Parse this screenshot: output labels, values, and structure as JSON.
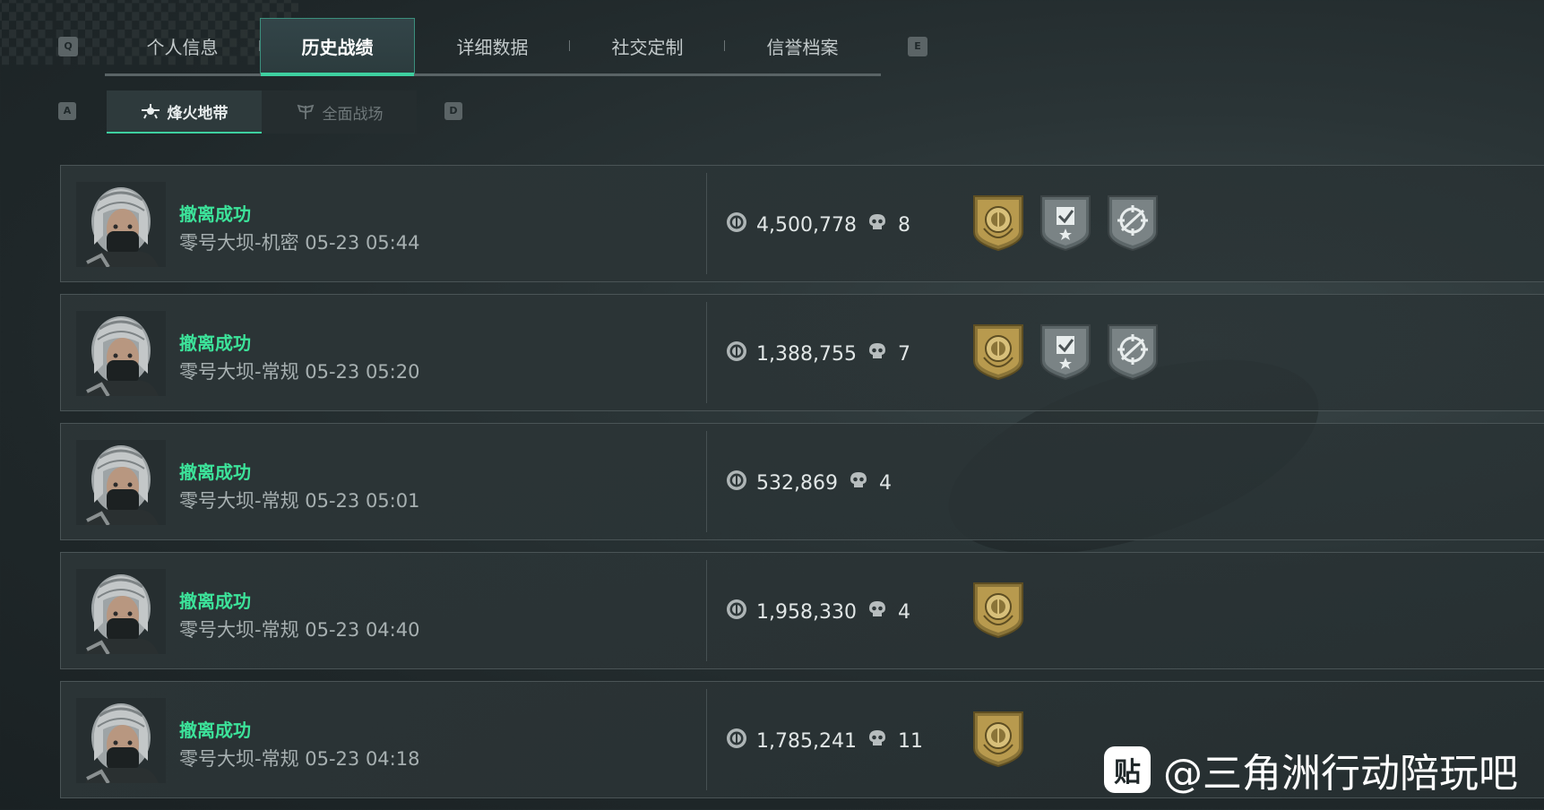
{
  "keys": {
    "prev_tab": "Q",
    "next_tab": "E",
    "prev_mode": "A",
    "next_mode": "D"
  },
  "tabs": [
    {
      "label": "个人信息",
      "active": false
    },
    {
      "label": "历史战绩",
      "active": true
    },
    {
      "label": "详细数据",
      "active": false
    },
    {
      "label": "社交定制",
      "active": false
    },
    {
      "label": "信誉档案",
      "active": false
    }
  ],
  "modes": [
    {
      "label": "烽火地带",
      "active": true,
      "icon": "drone-icon"
    },
    {
      "label": "全面战场",
      "active": false,
      "icon": "wings-icon"
    }
  ],
  "records": [
    {
      "status": "撤离成功",
      "map": "零号大坝-机密 05-23 05:44",
      "value": "4,500,778",
      "kills": "8",
      "badges": [
        "gold-shield-badge",
        "checkmark-star-badge",
        "crosshair-badge"
      ]
    },
    {
      "status": "撤离成功",
      "map": "零号大坝-常规 05-23 05:20",
      "value": "1,388,755",
      "kills": "7",
      "badges": [
        "gold-shield-badge",
        "checkmark-star-badge",
        "crosshair-badge"
      ]
    },
    {
      "status": "撤离成功",
      "map": "零号大坝-常规 05-23 05:01",
      "value": "532,869",
      "kills": "4",
      "badges": []
    },
    {
      "status": "撤离成功",
      "map": "零号大坝-常规 05-23 04:40",
      "value": "1,958,330",
      "kills": "4",
      "badges": [
        "gold-shield-badge"
      ]
    },
    {
      "status": "撤离成功",
      "map": "零号大坝-常规 05-23 04:18",
      "value": "1,785,241",
      "kills": "11",
      "badges": [
        "gold-shield-badge"
      ]
    }
  ],
  "watermark": {
    "icon_text": "贴",
    "text": "@三角洲行动陪玩吧"
  },
  "colors": {
    "accent": "#3ed0a0",
    "status": "#3ce39a",
    "gold": "#b89a4e"
  }
}
